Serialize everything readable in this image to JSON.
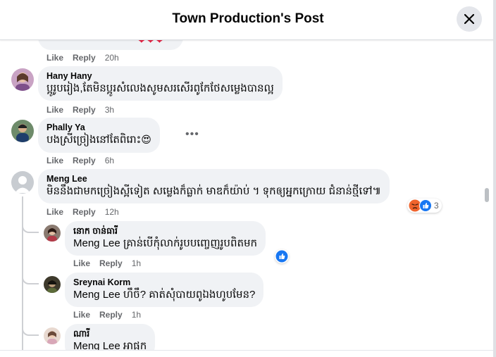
{
  "header": {
    "title": "Town Production's Post",
    "close_icon": "close-icon"
  },
  "colors": {
    "bubble": "#f0f2f5",
    "action_text": "#65676b",
    "like_blue": "#1877f2",
    "angry_orange": "#f0642d",
    "heart_red": "#e41e3f"
  },
  "action_labels": {
    "like": "Like",
    "reply": "Reply"
  },
  "comments": [
    {
      "author": "",
      "text": "",
      "emoji_text": "❤❤❤",
      "time": "20h"
    },
    {
      "author": "Hany Hany",
      "text": "ប្អូរូបរៀង,តែមិនប្អូរសំលេងសូមសរសើរពូកែថែសម្លេងបានល្អ",
      "time": "3h"
    },
    {
      "author": "Phally Ya",
      "text": "បងស្រីច្រៀងនៅតែពិរោះ",
      "emoji": "😍",
      "time": "6h",
      "more_icon": "more-options-icon"
    },
    {
      "author": "Meng Lee",
      "text": "មិននឹងជាមកច្រៀងស្អីទៀត សម្លេងក៏ធ្លាក់ មាឌក៏យ៉ាប់ ។ ទុកឲ្យអ្នកក្រោយ ជំនាន់ថ្មីទៅ៕",
      "time": "12h",
      "reactions": [
        "angry",
        "like"
      ],
      "reaction_count": "3",
      "replies": [
        {
          "author": "នោក ចាន់ធារី",
          "mention": "Meng Lee",
          "text": "គ្រាន់បើកុំលាក់រូបបញ្ចេញរូបពិតមក",
          "time": "1h",
          "reaction": "like"
        },
        {
          "author": "Sreynai Korm",
          "mention": "Meng Lee",
          "text": "ហឹចឹ? គាត់សុំបាយពូឯងហូបមែន?",
          "time": "1h"
        },
        {
          "author": "ណារី",
          "mention": "Meng Lee",
          "text": "អាផ្អក",
          "time": ""
        }
      ]
    }
  ]
}
